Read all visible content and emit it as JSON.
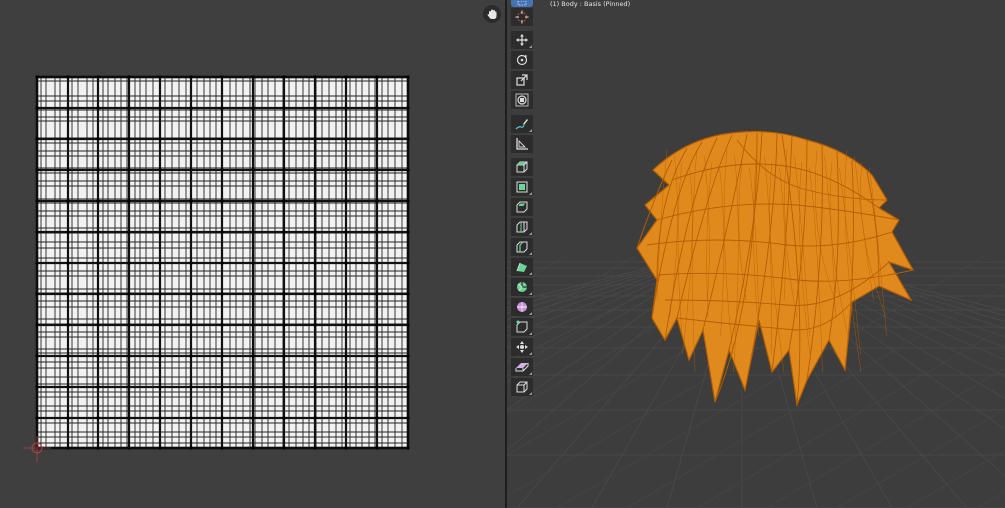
{
  "uv_editor": {
    "name": "UV Editor",
    "hand_icon": "hand-pan-icon",
    "cursor_icon": "2d-cursor-icon"
  },
  "viewport": {
    "object_info": "(1) Body : Basis (Pinned)",
    "hair_color": "#e08a1e",
    "wire_color": "#b45f00"
  },
  "toolbar": {
    "tools": [
      {
        "name": "select-box-icon",
        "label": "Select Box"
      },
      {
        "name": "cursor-icon",
        "label": "Cursor"
      },
      {
        "name": "move-icon",
        "label": "Move"
      },
      {
        "name": "rotate-icon",
        "label": "Rotate"
      },
      {
        "name": "scale-icon",
        "label": "Scale"
      },
      {
        "name": "transform-icon",
        "label": "Transform"
      },
      {
        "name": "annotate-icon",
        "label": "Annotate"
      },
      {
        "name": "measure-icon",
        "label": "Measure"
      },
      {
        "name": "add-cube-icon",
        "label": "Add Cube"
      },
      {
        "name": "extrude-region-icon",
        "label": "Extrude Region"
      },
      {
        "name": "inset-faces-icon",
        "label": "Inset Faces"
      },
      {
        "name": "bevel-icon",
        "label": "Bevel"
      },
      {
        "name": "loop-cut-icon",
        "label": "Loop Cut"
      },
      {
        "name": "knife-icon",
        "label": "Knife"
      },
      {
        "name": "poly-build-icon",
        "label": "Poly Build"
      },
      {
        "name": "spin-icon",
        "label": "Spin"
      },
      {
        "name": "smooth-icon",
        "label": "Smooth"
      },
      {
        "name": "edge-slide-icon",
        "label": "Edge Slide"
      },
      {
        "name": "shrink-fatten-icon",
        "label": "Shrink/Fatten"
      },
      {
        "name": "shear-icon",
        "label": "Shear"
      },
      {
        "name": "rip-region-icon",
        "label": "Rip Region"
      }
    ]
  }
}
